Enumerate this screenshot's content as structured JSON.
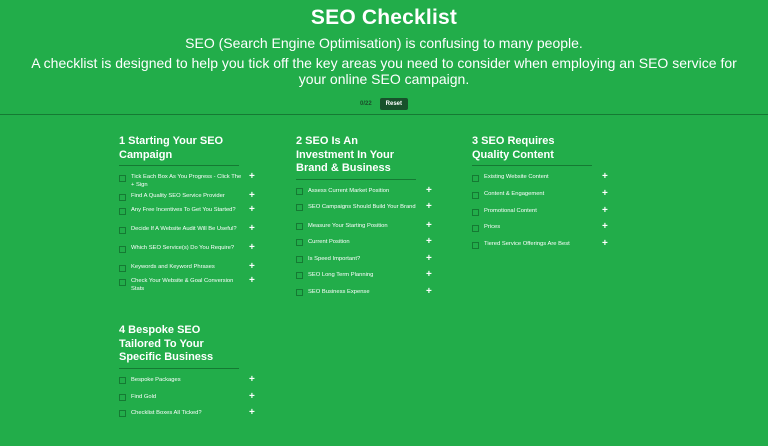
{
  "header": {
    "title": "SEO Checklist",
    "subtitle": "SEO (Search Engine Optimisation) is confusing to many people.",
    "description": "A checklist is designed to help you tick off the key areas you need to consider when employing an SEO service for your online SEO campaign.",
    "progress": "0/22",
    "reset_label": "Reset"
  },
  "sections": [
    {
      "title": "1 Starting Your SEO Campaign",
      "items": [
        "Tick Each Box As You Progress - Click The + Sign",
        "Find A Quality SEO Service Provider",
        "Any Free Incentives To Get You Started?",
        "Decide If A Website Audit Will Be Useful?",
        "Which SEO Service(s) Do You Require?",
        "Keywords and Keyword Phrases",
        "Check Your Website & Goal Conversion Stats"
      ]
    },
    {
      "title": "2 SEO Is An Investment In Your Brand & Business",
      "items": [
        "Assess Current Market Position",
        "SEO Campaigns Should Build Your Brand",
        "Measure Your Starting Position",
        "Current Position",
        "Is Speed Important?",
        "SEO Long Term Planning",
        "SEO Business Expense"
      ]
    },
    {
      "title": "3 SEO Requires Quality Content",
      "items": [
        "Existing Website Content",
        "Content & Engagement",
        "Promotional Content",
        "Prices",
        "Tiered Service Offerings Are Best"
      ]
    },
    {
      "title": "4 Bespoke SEO Tailored To Your Specific Business",
      "items": [
        "Bespoke Packages",
        "Find Gold",
        "Checklist Boxes All Ticked?"
      ]
    }
  ],
  "plus_symbol": "+",
  "colors": {
    "background": "#22ad4a",
    "divider": "#157a33",
    "button": "#18512b",
    "text": "#ffffff"
  }
}
